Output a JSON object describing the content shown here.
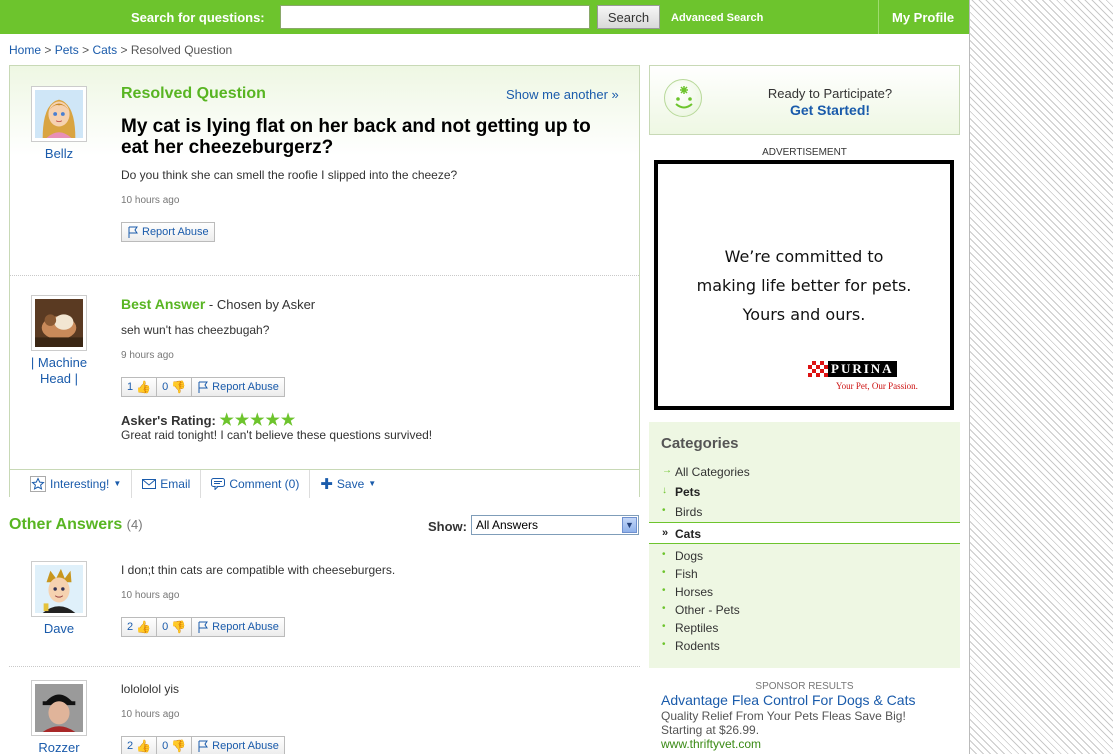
{
  "topbar": {
    "search_label": "Search for questions:",
    "search_value": "",
    "search_button": "Search",
    "advanced_search": "Advanced Search",
    "my_profile": "My Profile"
  },
  "breadcrumb": {
    "items": [
      "Home",
      "Pets",
      "Cats"
    ],
    "current": "Resolved Question",
    "separator": ">"
  },
  "question": {
    "heading": "Resolved Question",
    "show_me_another": "Show me another »",
    "title": "My cat is lying flat on her back and not getting up to eat her cheezeburgerz?",
    "body": "Do you think she can smell the roofie I slipped into the cheeze?",
    "time": "10 hours ago",
    "asker": "Bellz",
    "report_abuse": "Report Abuse"
  },
  "best_answer": {
    "label": "Best Answer",
    "chosen": " - Chosen by Asker",
    "author": "| Machine Head |",
    "body": "seh wun't has cheezbugah?",
    "time": "9 hours ago",
    "thumbs_up": "1",
    "thumbs_down": "0",
    "report_abuse": "Report Abuse",
    "rating_label": "Asker's Rating:",
    "rating_stars": "★★★★★",
    "rating_value": 5,
    "rating_comment": "Great raid tonight! I can't believe these questions survived!"
  },
  "actions": {
    "interesting": "Interesting!",
    "email": "Email",
    "comment": "Comment (0)",
    "save": "Save"
  },
  "other_answers": {
    "label": "Other Answers",
    "count": "(4)",
    "show_label": "Show:",
    "show_selected": "All Answers",
    "items": [
      {
        "author": "Dave",
        "body": "I don;t thin cats are compatible with cheeseburgers.",
        "time": "10 hours ago",
        "up": "2",
        "down": "0",
        "report": "Report Abuse"
      },
      {
        "author": "Rozzer",
        "body": "lolololol yis",
        "time": "10 hours ago",
        "up": "2",
        "down": "0",
        "report": "Report Abuse"
      }
    ]
  },
  "participate": {
    "ready": "Ready to Participate?",
    "get_started": "Get Started!"
  },
  "advertisement": {
    "label": "ADVERTISEMENT",
    "line1": "We’re committed to",
    "line2": "making life better for pets.",
    "line3": "Yours and ours.",
    "brand": "PURINA",
    "tagline": "Your Pet, Our Passion."
  },
  "categories": {
    "heading": "Categories",
    "all": "All Categories",
    "parent": "Pets",
    "items_before": [
      "Birds"
    ],
    "selected": "Cats",
    "items_after": [
      "Dogs",
      "Fish",
      "Horses",
      "Other - Pets",
      "Reptiles",
      "Rodents"
    ]
  },
  "sponsor": {
    "label": "SPONSOR RESULTS",
    "title": "Advantage Flea Control For Dogs & Cats",
    "desc1": "Quality Relief From Your Pets Fleas Save Big!",
    "desc2": "Starting at $26.99.",
    "url": "www.thriftyvet.com"
  },
  "colors": {
    "brand_green": "#6dc42d",
    "link_blue": "#1a5bab",
    "panel_green": "#eef7e3"
  }
}
